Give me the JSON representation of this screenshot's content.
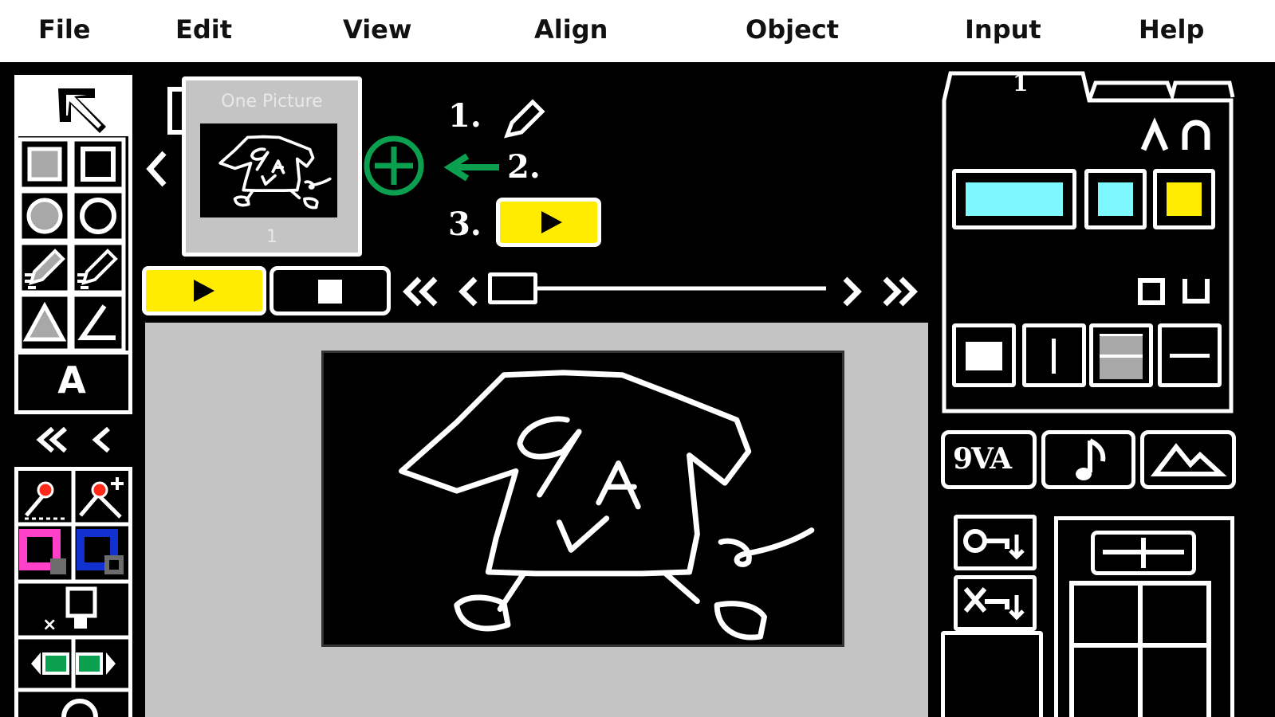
{
  "menu": {
    "file": "File",
    "edit": "Edit",
    "view": "View",
    "align": "Align",
    "object": "Object",
    "input": "Input",
    "help": "Help"
  },
  "frames": {
    "thumbnail_title": "One Picture",
    "thumbnail_number": "1"
  },
  "steps": {
    "step1": "1.",
    "step2": "2.",
    "step3": "3."
  },
  "tools": {
    "text_tool_glyph": "A"
  },
  "panel": {
    "tab1_label": "1",
    "font_button_label": "9VA"
  },
  "colors": {
    "play_yellow": "#ffec00",
    "cyan": "#7ef8ff",
    "add_green": "#0aa050",
    "magenta": "#ff40c8",
    "blue": "#1030d0",
    "gray_stage": "#c4c4c4"
  }
}
